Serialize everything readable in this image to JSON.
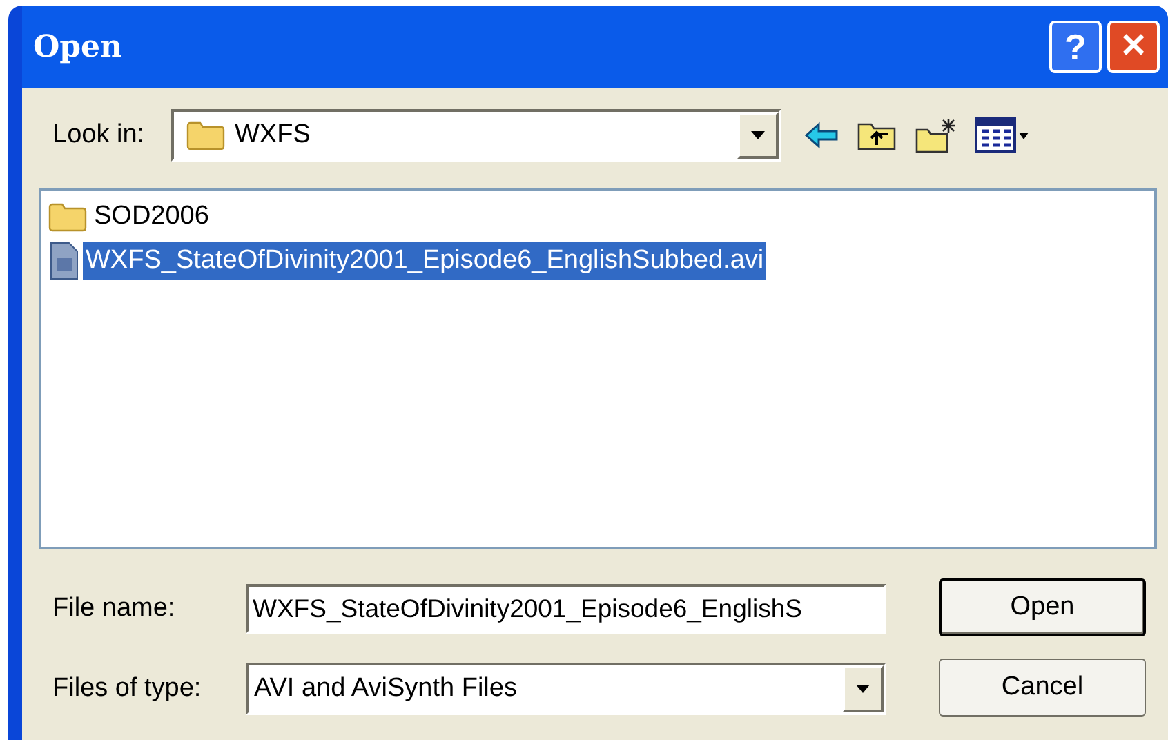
{
  "window": {
    "title": "Open",
    "title_buttons": [
      "?",
      "✕"
    ]
  },
  "look_in": {
    "label": "Look in:",
    "value": "WXFS"
  },
  "files": [
    {
      "kind": "folder",
      "name": "SOD2006",
      "selected": false
    },
    {
      "kind": "video",
      "name": "WXFS_StateOfDivinity2001_Episode6_EnglishSubbed.avi",
      "selected": true
    }
  ],
  "file_name": {
    "label": "File name:",
    "value": "WXFS_StateOfDivinity2001_Episode6_EnglishS"
  },
  "file_type": {
    "label": "Files of type:",
    "value": "AVI and AviSynth Files"
  },
  "buttons": [
    "Open",
    "Cancel"
  ]
}
